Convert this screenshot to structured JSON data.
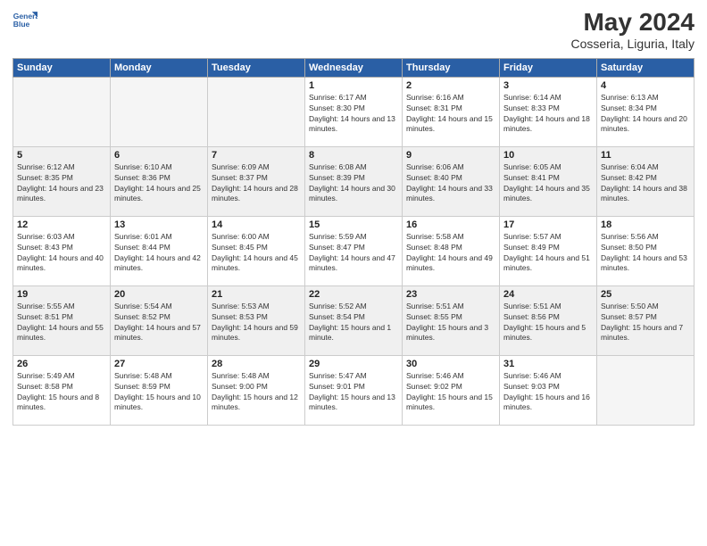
{
  "logo": {
    "line1": "General",
    "line2": "Blue"
  },
  "title": "May 2024",
  "location": "Cosseria, Liguria, Italy",
  "days_of_week": [
    "Sunday",
    "Monday",
    "Tuesday",
    "Wednesday",
    "Thursday",
    "Friday",
    "Saturday"
  ],
  "weeks": [
    [
      {
        "day": "",
        "empty": true
      },
      {
        "day": "",
        "empty": true
      },
      {
        "day": "",
        "empty": true
      },
      {
        "day": "1",
        "sunrise": "Sunrise: 6:17 AM",
        "sunset": "Sunset: 8:30 PM",
        "daylight": "Daylight: 14 hours and 13 minutes."
      },
      {
        "day": "2",
        "sunrise": "Sunrise: 6:16 AM",
        "sunset": "Sunset: 8:31 PM",
        "daylight": "Daylight: 14 hours and 15 minutes."
      },
      {
        "day": "3",
        "sunrise": "Sunrise: 6:14 AM",
        "sunset": "Sunset: 8:33 PM",
        "daylight": "Daylight: 14 hours and 18 minutes."
      },
      {
        "day": "4",
        "sunrise": "Sunrise: 6:13 AM",
        "sunset": "Sunset: 8:34 PM",
        "daylight": "Daylight: 14 hours and 20 minutes."
      }
    ],
    [
      {
        "day": "5",
        "sunrise": "Sunrise: 6:12 AM",
        "sunset": "Sunset: 8:35 PM",
        "daylight": "Daylight: 14 hours and 23 minutes."
      },
      {
        "day": "6",
        "sunrise": "Sunrise: 6:10 AM",
        "sunset": "Sunset: 8:36 PM",
        "daylight": "Daylight: 14 hours and 25 minutes."
      },
      {
        "day": "7",
        "sunrise": "Sunrise: 6:09 AM",
        "sunset": "Sunset: 8:37 PM",
        "daylight": "Daylight: 14 hours and 28 minutes."
      },
      {
        "day": "8",
        "sunrise": "Sunrise: 6:08 AM",
        "sunset": "Sunset: 8:39 PM",
        "daylight": "Daylight: 14 hours and 30 minutes."
      },
      {
        "day": "9",
        "sunrise": "Sunrise: 6:06 AM",
        "sunset": "Sunset: 8:40 PM",
        "daylight": "Daylight: 14 hours and 33 minutes."
      },
      {
        "day": "10",
        "sunrise": "Sunrise: 6:05 AM",
        "sunset": "Sunset: 8:41 PM",
        "daylight": "Daylight: 14 hours and 35 minutes."
      },
      {
        "day": "11",
        "sunrise": "Sunrise: 6:04 AM",
        "sunset": "Sunset: 8:42 PM",
        "daylight": "Daylight: 14 hours and 38 minutes."
      }
    ],
    [
      {
        "day": "12",
        "sunrise": "Sunrise: 6:03 AM",
        "sunset": "Sunset: 8:43 PM",
        "daylight": "Daylight: 14 hours and 40 minutes."
      },
      {
        "day": "13",
        "sunrise": "Sunrise: 6:01 AM",
        "sunset": "Sunset: 8:44 PM",
        "daylight": "Daylight: 14 hours and 42 minutes."
      },
      {
        "day": "14",
        "sunrise": "Sunrise: 6:00 AM",
        "sunset": "Sunset: 8:45 PM",
        "daylight": "Daylight: 14 hours and 45 minutes."
      },
      {
        "day": "15",
        "sunrise": "Sunrise: 5:59 AM",
        "sunset": "Sunset: 8:47 PM",
        "daylight": "Daylight: 14 hours and 47 minutes."
      },
      {
        "day": "16",
        "sunrise": "Sunrise: 5:58 AM",
        "sunset": "Sunset: 8:48 PM",
        "daylight": "Daylight: 14 hours and 49 minutes."
      },
      {
        "day": "17",
        "sunrise": "Sunrise: 5:57 AM",
        "sunset": "Sunset: 8:49 PM",
        "daylight": "Daylight: 14 hours and 51 minutes."
      },
      {
        "day": "18",
        "sunrise": "Sunrise: 5:56 AM",
        "sunset": "Sunset: 8:50 PM",
        "daylight": "Daylight: 14 hours and 53 minutes."
      }
    ],
    [
      {
        "day": "19",
        "sunrise": "Sunrise: 5:55 AM",
        "sunset": "Sunset: 8:51 PM",
        "daylight": "Daylight: 14 hours and 55 minutes."
      },
      {
        "day": "20",
        "sunrise": "Sunrise: 5:54 AM",
        "sunset": "Sunset: 8:52 PM",
        "daylight": "Daylight: 14 hours and 57 minutes."
      },
      {
        "day": "21",
        "sunrise": "Sunrise: 5:53 AM",
        "sunset": "Sunset: 8:53 PM",
        "daylight": "Daylight: 14 hours and 59 minutes."
      },
      {
        "day": "22",
        "sunrise": "Sunrise: 5:52 AM",
        "sunset": "Sunset: 8:54 PM",
        "daylight": "Daylight: 15 hours and 1 minute."
      },
      {
        "day": "23",
        "sunrise": "Sunrise: 5:51 AM",
        "sunset": "Sunset: 8:55 PM",
        "daylight": "Daylight: 15 hours and 3 minutes."
      },
      {
        "day": "24",
        "sunrise": "Sunrise: 5:51 AM",
        "sunset": "Sunset: 8:56 PM",
        "daylight": "Daylight: 15 hours and 5 minutes."
      },
      {
        "day": "25",
        "sunrise": "Sunrise: 5:50 AM",
        "sunset": "Sunset: 8:57 PM",
        "daylight": "Daylight: 15 hours and 7 minutes."
      }
    ],
    [
      {
        "day": "26",
        "sunrise": "Sunrise: 5:49 AM",
        "sunset": "Sunset: 8:58 PM",
        "daylight": "Daylight: 15 hours and 8 minutes."
      },
      {
        "day": "27",
        "sunrise": "Sunrise: 5:48 AM",
        "sunset": "Sunset: 8:59 PM",
        "daylight": "Daylight: 15 hours and 10 minutes."
      },
      {
        "day": "28",
        "sunrise": "Sunrise: 5:48 AM",
        "sunset": "Sunset: 9:00 PM",
        "daylight": "Daylight: 15 hours and 12 minutes."
      },
      {
        "day": "29",
        "sunrise": "Sunrise: 5:47 AM",
        "sunset": "Sunset: 9:01 PM",
        "daylight": "Daylight: 15 hours and 13 minutes."
      },
      {
        "day": "30",
        "sunrise": "Sunrise: 5:46 AM",
        "sunset": "Sunset: 9:02 PM",
        "daylight": "Daylight: 15 hours and 15 minutes."
      },
      {
        "day": "31",
        "sunrise": "Sunrise: 5:46 AM",
        "sunset": "Sunset: 9:03 PM",
        "daylight": "Daylight: 15 hours and 16 minutes."
      },
      {
        "day": "",
        "empty": true
      }
    ]
  ]
}
